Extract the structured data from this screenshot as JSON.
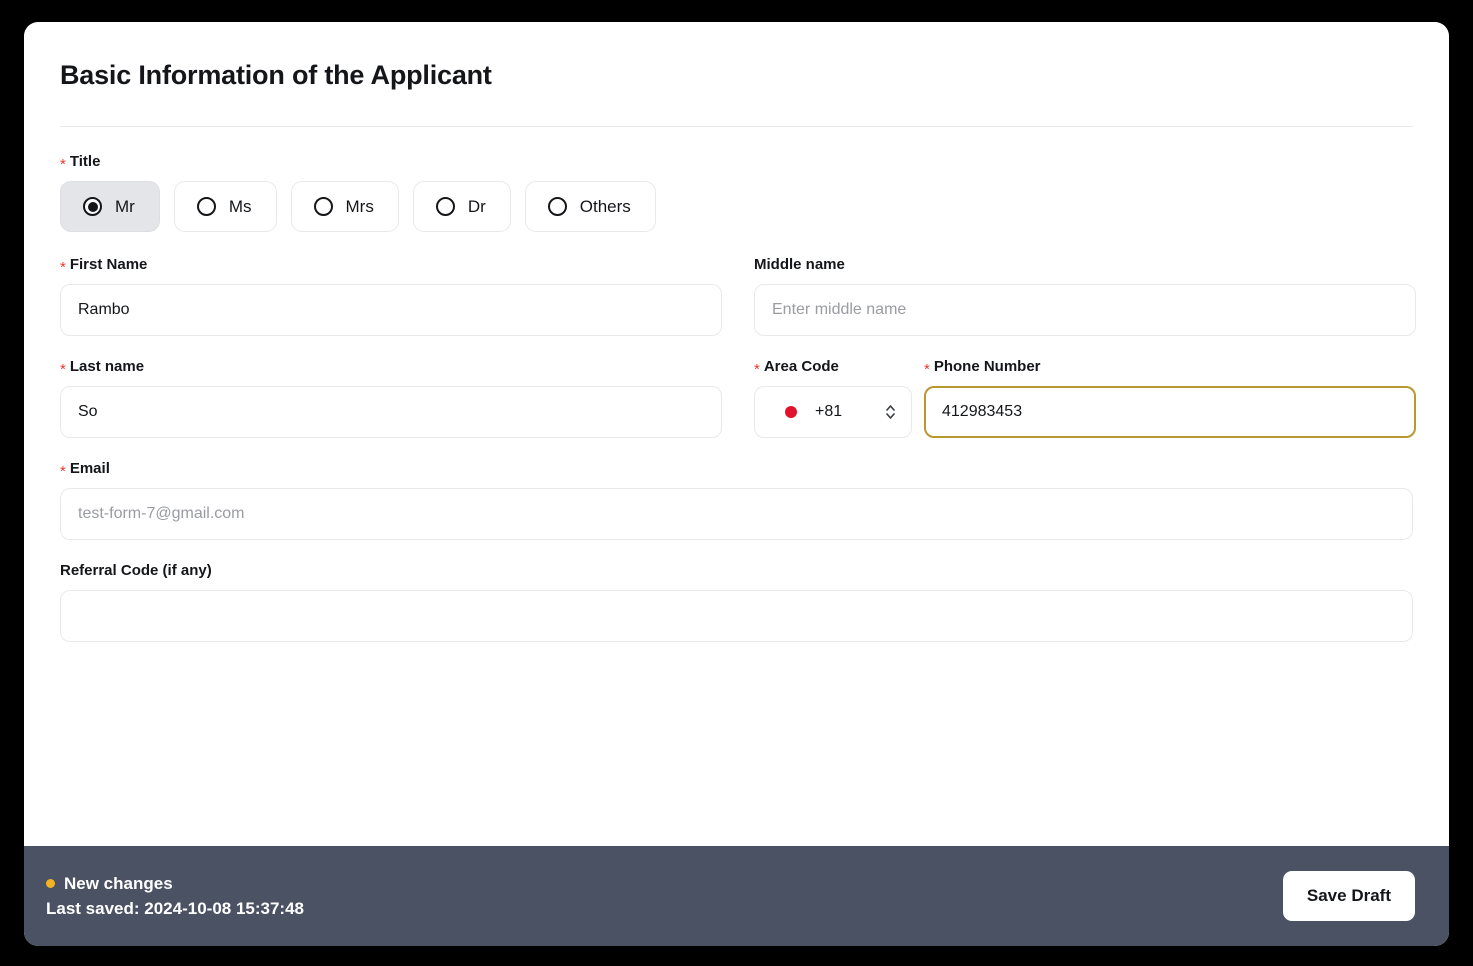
{
  "page": {
    "title": "Basic Information of the Applicant"
  },
  "title_field": {
    "label": "Title",
    "required": true,
    "options": [
      {
        "label": "Mr",
        "selected": true
      },
      {
        "label": "Ms",
        "selected": false
      },
      {
        "label": "Mrs",
        "selected": false
      },
      {
        "label": "Dr",
        "selected": false
      },
      {
        "label": "Others",
        "selected": false
      }
    ]
  },
  "first_name": {
    "label": "First Name",
    "required": true,
    "value": "Rambo",
    "placeholder": ""
  },
  "middle_name": {
    "label": "Middle name",
    "required": false,
    "value": "",
    "placeholder": "Enter middle name"
  },
  "last_name": {
    "label": "Last name",
    "required": true,
    "value": "So",
    "placeholder": ""
  },
  "area_code": {
    "label": "Area Code",
    "required": true,
    "value": "+81",
    "flag": "japan-flag-icon",
    "stepper_icon": "chevron-up-down-icon"
  },
  "phone_number": {
    "label": "Phone Number",
    "required": true,
    "value": "412983453",
    "placeholder": "",
    "focused": true,
    "focus_color": "#b8992f"
  },
  "email": {
    "label": "Email",
    "required": true,
    "value": "",
    "placeholder": "test-form-7@gmail.com"
  },
  "referral_code": {
    "label": "Referral Code (if any)",
    "required": false,
    "value": "",
    "placeholder": ""
  },
  "footer": {
    "status_label": "New changes",
    "status_dot_color": "#f2b325",
    "last_saved": "Last saved: 2024-10-08 15:37:48",
    "save_label": "Save Draft",
    "background": "#4b5263"
  },
  "required_marker": "*"
}
